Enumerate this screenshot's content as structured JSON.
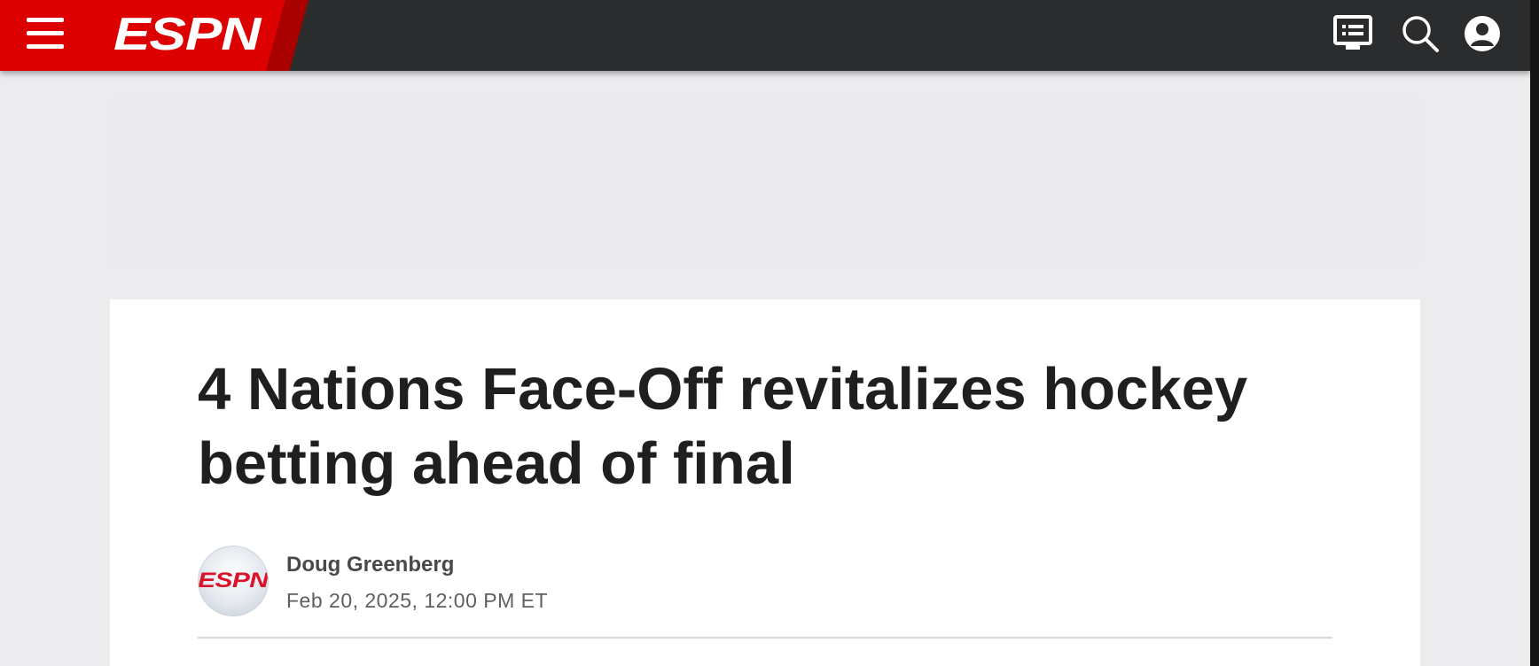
{
  "header": {
    "logo_text": "ESPN",
    "menu_icon": "hamburger-menu-icon",
    "right_icons": [
      "guide-list-icon",
      "search-icon",
      "profile-icon"
    ],
    "brand_color": "#dd0000",
    "bar_color": "#2b2c2d"
  },
  "article": {
    "headline": "4 Nations Face-Off revitalizes hockey betting ahead of final",
    "author": {
      "name": "Doug Greenberg",
      "avatar_logo_text": "ESPN"
    },
    "published": "Feb 20, 2025, 12:00 PM ET"
  }
}
